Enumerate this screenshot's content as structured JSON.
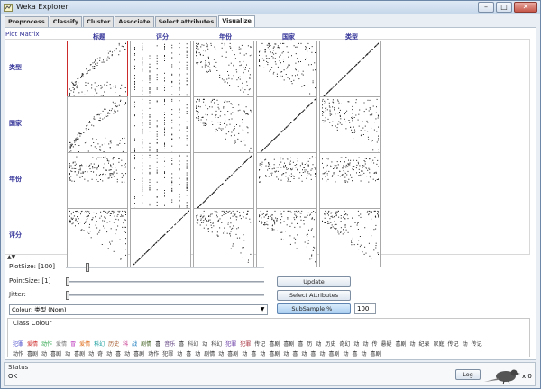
{
  "window": {
    "title": "Weka Explorer",
    "minimize": "–",
    "maximize": "□",
    "close": "✕"
  },
  "tabs": [
    {
      "label": "Preprocess"
    },
    {
      "label": "Classify"
    },
    {
      "label": "Cluster"
    },
    {
      "label": "Associate"
    },
    {
      "label": "Select attributes"
    },
    {
      "label": "Visualize",
      "active": true
    }
  ],
  "plot_matrix": {
    "title": "Plot Matrix",
    "columns": [
      "标题",
      "评分",
      "年份",
      "国家",
      "类型"
    ],
    "rows": [
      "类型",
      "国家",
      "年份",
      "评分"
    ],
    "selected_cell": {
      "row": 0,
      "col": 0
    },
    "scroll_arrows": "▲▼"
  },
  "controls": {
    "plot_size_label": "PlotSize: [100]",
    "point_size_label": "PointSize: [1]",
    "jitter_label": "Jitter:",
    "plot_size_value": 100,
    "point_size_value": 1,
    "jitter_value": 0,
    "colour_label": "Colour: 类型  (Nom)",
    "update_button": "Update",
    "select_attributes_button": "Select Attributes",
    "subsample_button": "SubSample % :",
    "subsample_value": "100"
  },
  "class_colour": {
    "title": "Class Colour",
    "row1": [
      {
        "text": "犯罪",
        "color": "#3c3cc8"
      },
      {
        "text": "爱情",
        "color": "#d03030"
      },
      {
        "text": "动作",
        "color": "#20a040"
      },
      {
        "text": "爱情",
        "color": "#7a7a7a"
      },
      {
        "text": "冒",
        "color": "#c040c0"
      },
      {
        "text": "爱情",
        "color": "#e07020"
      },
      {
        "text": "科幻",
        "color": "#20a0a0"
      },
      {
        "text": "历史",
        "color": "#a05020"
      },
      {
        "text": "科",
        "color": "#c02080"
      },
      {
        "text": "战",
        "color": "#2080c0"
      },
      {
        "text": "剧情",
        "color": "#406020"
      },
      {
        "text": "喜",
        "color": "#202020"
      },
      {
        "text": "音乐",
        "color": "#604080"
      },
      {
        "text": "喜",
        "color": "#303030"
      },
      {
        "text": "科幻",
        "color": "#505050"
      },
      {
        "text": "动",
        "color": "#303030"
      },
      {
        "text": "科幻",
        "color": "#404040"
      },
      {
        "text": "犯罪",
        "color": "#6030a0"
      },
      {
        "text": "犯罪",
        "color": "#a02030"
      },
      {
        "text": "传记",
        "color": "#303030"
      },
      {
        "text": "喜剧",
        "color": "#303030"
      },
      {
        "text": "喜剧",
        "color": "#303030"
      },
      {
        "text": "喜",
        "color": "#303030"
      },
      {
        "text": "历",
        "color": "#303030"
      },
      {
        "text": "动",
        "color": "#303030"
      },
      {
        "text": "历史",
        "color": "#303030"
      },
      {
        "text": "奇幻",
        "color": "#303030"
      },
      {
        "text": "动",
        "color": "#303030"
      },
      {
        "text": "动",
        "color": "#303030"
      },
      {
        "text": "传",
        "color": "#303030"
      },
      {
        "text": "悬疑",
        "color": "#303030"
      },
      {
        "text": "喜剧",
        "color": "#303030"
      },
      {
        "text": "动",
        "color": "#303030"
      },
      {
        "text": "纪录",
        "color": "#303030"
      },
      {
        "text": "家庭",
        "color": "#303030"
      },
      {
        "text": "传记",
        "color": "#303030"
      },
      {
        "text": "动",
        "color": "#303030"
      },
      {
        "text": "传记",
        "color": "#303030"
      }
    ],
    "row2": [
      {
        "text": "动作",
        "color": "#303030"
      },
      {
        "text": "喜剧",
        "color": "#303030"
      },
      {
        "text": "动",
        "color": "#303030"
      },
      {
        "text": "喜剧",
        "color": "#303030"
      },
      {
        "text": "动",
        "color": "#303030"
      },
      {
        "text": "喜剧",
        "color": "#303030"
      },
      {
        "text": "动",
        "color": "#303030"
      },
      {
        "text": "奇",
        "color": "#303030"
      },
      {
        "text": "动",
        "color": "#303030"
      },
      {
        "text": "喜",
        "color": "#303030"
      },
      {
        "text": "动",
        "color": "#303030"
      },
      {
        "text": "喜剧",
        "color": "#303030"
      },
      {
        "text": "动作",
        "color": "#303030"
      },
      {
        "text": "犯罪",
        "color": "#303030"
      },
      {
        "text": "动",
        "color": "#303030"
      },
      {
        "text": "喜",
        "color": "#303030"
      },
      {
        "text": "动",
        "color": "#303030"
      },
      {
        "text": "剧情",
        "color": "#303030"
      },
      {
        "text": "动",
        "color": "#303030"
      },
      {
        "text": "喜剧",
        "color": "#303030"
      },
      {
        "text": "动",
        "color": "#303030"
      },
      {
        "text": "喜",
        "color": "#303030"
      },
      {
        "text": "动",
        "color": "#303030"
      },
      {
        "text": "喜剧",
        "color": "#303030"
      },
      {
        "text": "动",
        "color": "#303030"
      },
      {
        "text": "喜",
        "color": "#303030"
      },
      {
        "text": "动",
        "color": "#303030"
      },
      {
        "text": "喜",
        "color": "#303030"
      },
      {
        "text": "动",
        "color": "#303030"
      },
      {
        "text": "喜剧",
        "color": "#303030"
      },
      {
        "text": "动",
        "color": "#303030"
      },
      {
        "text": "喜",
        "color": "#303030"
      },
      {
        "text": "动",
        "color": "#303030"
      },
      {
        "text": "喜剧",
        "color": "#303030"
      }
    ]
  },
  "status": {
    "title": "Status",
    "text": "OK",
    "log_button": "Log",
    "x_count": "x 0"
  }
}
